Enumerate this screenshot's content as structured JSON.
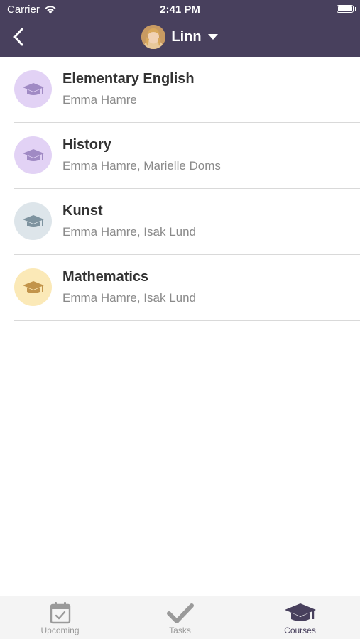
{
  "status_bar": {
    "carrier": "Carrier",
    "time": "2:41 PM"
  },
  "header": {
    "profile_name": "Linn",
    "back_icon": "chevron-left-icon",
    "dropdown_icon": "caret-down-icon"
  },
  "colors": {
    "header_bg": "#48405d",
    "icon_purple_bg": "#e2d2f5",
    "icon_purple": "#a08ac4",
    "icon_gray_bg": "#dde5ea",
    "icon_gray": "#7e939f",
    "icon_yellow_bg": "#fbe9b7",
    "icon_yellow": "#c2944a",
    "tab_active": "#48405d",
    "tab_inactive": "#9a9a9a"
  },
  "courses": [
    {
      "name": "Elementary English",
      "teachers": "Emma Hamre",
      "icon": "graduation-cap-icon",
      "color": "purple"
    },
    {
      "name": "History",
      "teachers": "Emma Hamre, Marielle Doms",
      "icon": "graduation-cap-icon",
      "color": "purple"
    },
    {
      "name": "Kunst",
      "teachers": "Emma Hamre, Isak Lund",
      "icon": "graduation-cap-icon",
      "color": "gray"
    },
    {
      "name": "Mathematics",
      "teachers": "Emma Hamre, Isak Lund",
      "icon": "graduation-cap-icon",
      "color": "yellow"
    }
  ],
  "tab_bar": {
    "tabs": [
      {
        "label": "Upcoming",
        "icon": "calendar-check-icon",
        "active": false
      },
      {
        "label": "Tasks",
        "icon": "checkmark-icon",
        "active": false
      },
      {
        "label": "Courses",
        "icon": "graduation-cap-icon",
        "active": true
      }
    ]
  }
}
